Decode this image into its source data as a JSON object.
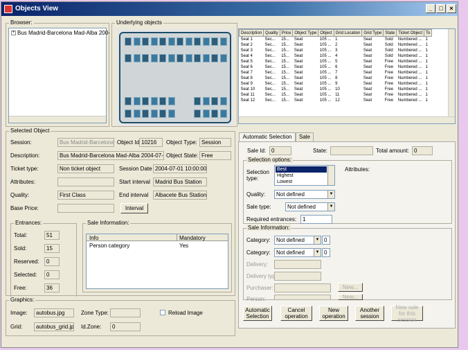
{
  "window": {
    "title": "Objects View"
  },
  "browser": {
    "label": "Browser:",
    "tree_item": "Bus Madrid-Barcelona Mad-Alba 200-"
  },
  "underlying": {
    "label": "Underlying objects"
  },
  "objects_table": {
    "columns": [
      "Description",
      "Quality",
      "Price",
      "Object Type",
      "Object",
      "Grid Location",
      "Grid Type",
      "State",
      "Ticket Object",
      "To"
    ],
    "rows": [
      [
        "Seat 1",
        "Sec...",
        "15...",
        "Seat",
        "105 ...",
        "1",
        "Seat",
        "Sold",
        "Numbered ...",
        "1"
      ],
      [
        "Seat 2",
        "Sec...",
        "15...",
        "Seat",
        "105 ...",
        "2",
        "Seat",
        "Sold",
        "Numbered ...",
        "1"
      ],
      [
        "Seat 3",
        "Sec...",
        "15...",
        "Seat",
        "105 ...",
        "3",
        "Seat",
        "Sold",
        "Numbered ...",
        "1"
      ],
      [
        "Seat 4",
        "Sec...",
        "15...",
        "Seat",
        "105 ...",
        "4",
        "Seat",
        "Sold",
        "Numbered ...",
        "1"
      ],
      [
        "Seat 5",
        "Sec...",
        "15...",
        "Seat",
        "105 ...",
        "5",
        "Seat",
        "Free",
        "Numbered ...",
        "1"
      ],
      [
        "Seat 6",
        "Sec...",
        "15...",
        "Seat",
        "105 ...",
        "6",
        "Seat",
        "Free",
        "Numbered ...",
        "1"
      ],
      [
        "Seat 7",
        "Sec...",
        "15...",
        "Seat",
        "105 ...",
        "7",
        "Seat",
        "Free",
        "Numbered ...",
        "1"
      ],
      [
        "Seat 8",
        "Sec...",
        "15...",
        "Seat",
        "105 ...",
        "8",
        "Seat",
        "Free",
        "Numbered ...",
        "1"
      ],
      [
        "Seat 9",
        "Sec...",
        "15...",
        "Seat",
        "105 ...",
        "9",
        "Seat",
        "Free",
        "Numbered ...",
        "1"
      ],
      [
        "Seat 10",
        "Sec...",
        "15...",
        "Seat",
        "105 ...",
        "10",
        "Seat",
        "Free",
        "Numbered ...",
        "1"
      ],
      [
        "Seat 11",
        "Sec...",
        "15...",
        "Seat",
        "105 ...",
        "11",
        "Seat",
        "Free",
        "Numbered ...",
        "1"
      ],
      [
        "Seat 12",
        "Sec...",
        "15...",
        "Seat",
        "105 ...",
        "12",
        "Seat",
        "Free",
        "Numbered ...",
        "1"
      ]
    ]
  },
  "selected": {
    "label": "Selected Object",
    "session_label": "Session:",
    "session_value": "Bus Madrid-Barcelona M",
    "object_id_label": "Object Id:",
    "object_id_value": "10216",
    "object_type_label": "Object Type:",
    "object_type_value": "Session",
    "description_label": "Description:",
    "description_value": "Bus Madrid-Barcelona Mad-Alba 2004-07-01 10:",
    "object_state_label": "Object State:",
    "object_state_value": "Free",
    "ticket_type_label": "Ticket type:",
    "ticket_type_value": "Non ticket object",
    "session_date_label": "Session Date",
    "session_date_value": "2004-07-01 10:00:00",
    "attributes_label": "Attributes:",
    "attributes_value": "",
    "start_interval_label": "Start interval",
    "start_interval_value": "Madrid Bus Station",
    "quality_label": "Quality:",
    "quality_value": "First Class",
    "end_interval_label": "End interval",
    "end_interval_value": "Albacete Bus Station",
    "base_price_label": "Base Price:",
    "base_price_value": "",
    "interval_button": "Interval"
  },
  "entrances": {
    "label": "Entrances:",
    "total_label": "Total:",
    "total_value": "51",
    "sold_label": "Sold:",
    "sold_value": "15",
    "reserved_label": "Reserved:",
    "reserved_value": "0",
    "selected_label": "Selected:",
    "selected_value": "0",
    "free_label": "Free:",
    "free_value": "36"
  },
  "sale_info": {
    "label": "Sale Information:",
    "col_info": "Info",
    "col_mandatory": "Mandatory",
    "row_info": "Person category",
    "row_mandatory": "Yes"
  },
  "graphics": {
    "label": "Graphics:",
    "image_label": "Image:",
    "image_value": "autobus.jpg",
    "zone_type_label": "Zone Type:",
    "zone_type_value": "",
    "reload_label": "Reload Image",
    "grid_label": "Grid:",
    "grid_value": "autobus_grid.jpg",
    "id_zone_label": "Id.Zone:",
    "id_zone_value": "0"
  },
  "tabs": [
    "Automatic Selection",
    "Sale"
  ],
  "sale": {
    "sale_id_label": "Sale Id:",
    "sale_id_value": "0",
    "state_label": "State:",
    "state_value": "",
    "total_amount_label": "Total amount:",
    "total_amount_value": "0",
    "selection_options_label": "Selection options:",
    "selection_type_label": "Selection type:",
    "selection_type_options": [
      "Best",
      "Highest",
      "Lowest"
    ],
    "attributes_label": "Attributes:",
    "quality_label": "Quality:",
    "quality_value": "Not defined",
    "sale_type_label": "Sale type:",
    "sale_type_value": "Not defined",
    "required_entrances_label": "Required entrances:",
    "required_entrances_value": "1",
    "sale_information_label": "Sale Information:",
    "category1_label": "Category:",
    "category1_value": "Not defined",
    "category1_num": "0",
    "category2_label": "Category:",
    "category2_value": "Not defined",
    "category2_num": "0",
    "delivery_label": "Delivery:",
    "delivery_type_label": "Delivery typ:",
    "purchaser_label": "Purchaser:",
    "person_label": "Person:",
    "new_button": "New...",
    "new_button2": "New..."
  },
  "actions": {
    "automatic_selection": "Automatic Selection",
    "cancel_operation": "Cancel operation",
    "new_operation": "New operation",
    "another_session": "Another session",
    "new_sale": "New sale for this session"
  }
}
